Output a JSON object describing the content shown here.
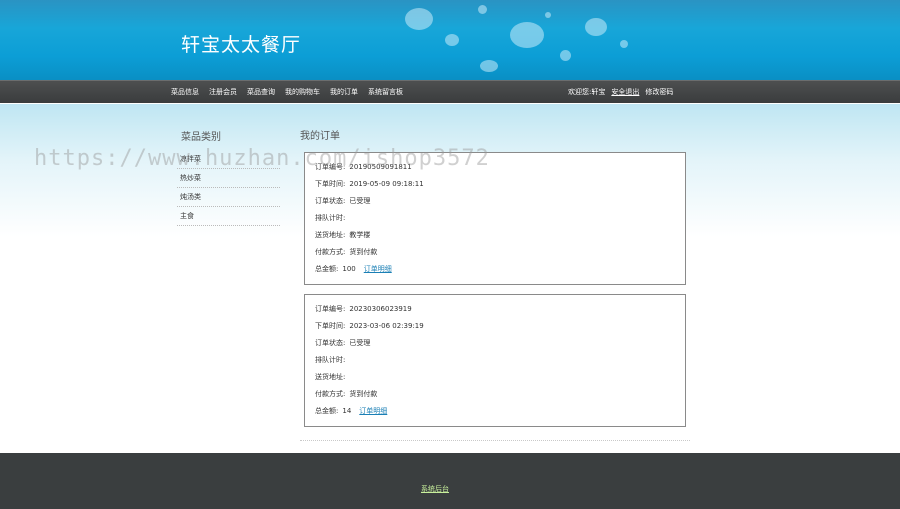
{
  "header": {
    "site_title": "轩宝太太餐厅"
  },
  "nav": {
    "links": [
      "菜品信息",
      "注册会员",
      "菜品查询",
      "我的购物车",
      "我的订单",
      "系统留言板"
    ],
    "welcome": "欢迎您:",
    "username": "轩宝",
    "logout": "安全退出",
    "change_password": "修改密码"
  },
  "sidebar": {
    "title": "菜品类别",
    "items": [
      "凉拌菜",
      "热炒菜",
      "炖汤类",
      "主食"
    ]
  },
  "main": {
    "title": "我的订单",
    "labels": {
      "order_no": "订单编号:",
      "order_time": "下单时间:",
      "status": "订单状态:",
      "queue": "排队计时:",
      "address": "送货地址:",
      "payment": "付款方式:",
      "total": "总金额:"
    },
    "detail_link": "订单明细",
    "orders": [
      {
        "order_no": "20190509091811",
        "order_time": "2019-05-09 09:18:11",
        "status": "已受理",
        "queue": "",
        "address": "教学楼",
        "payment": "货到付款",
        "total": "100"
      },
      {
        "order_no": "20230306023919",
        "order_time": "2023-03-06 02:39:19",
        "status": "已受理",
        "queue": "",
        "address": "",
        "payment": "货到付款",
        "total": "14"
      }
    ]
  },
  "footer": {
    "admin_link": "系统后台"
  },
  "watermark": "https://www.huzhan.com/ishop3572",
  "colors": {
    "banner": "#0c9ed6",
    "navbar": "#3e4041",
    "footer": "#3a3e3f",
    "link": "#1a7fb5",
    "footer_link": "#c8f09c"
  }
}
